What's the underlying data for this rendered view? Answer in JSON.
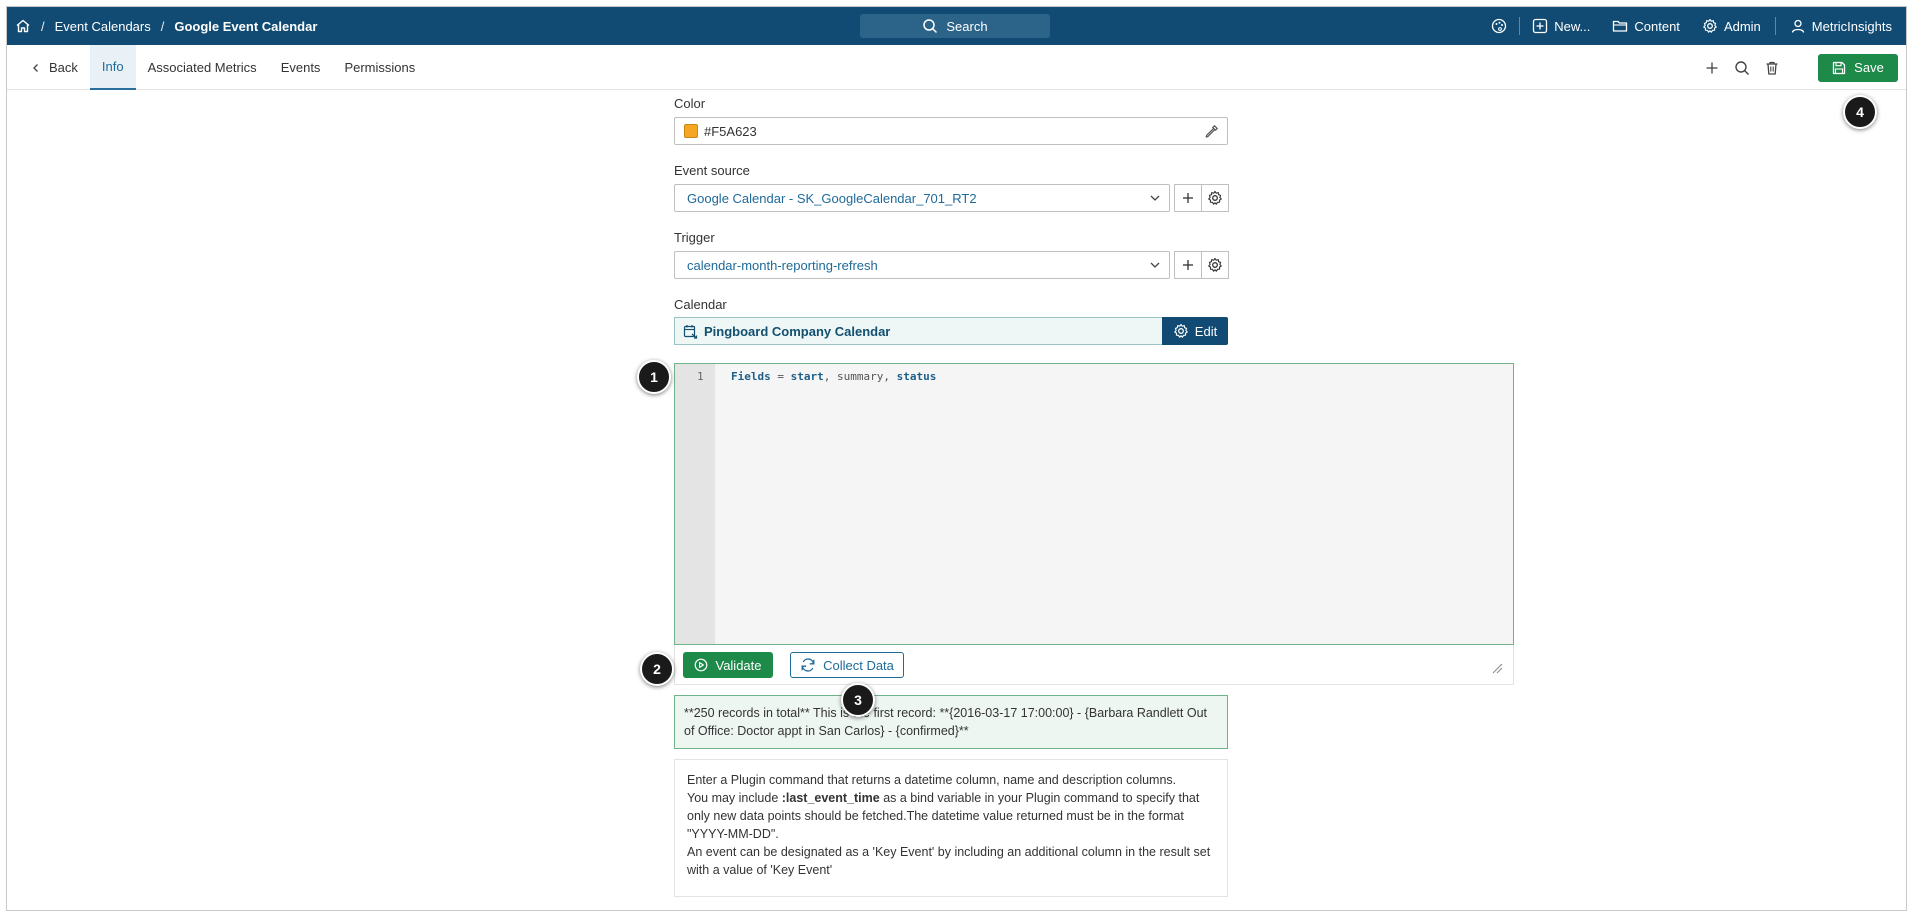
{
  "header": {
    "breadcrumbs": [
      "Event Calendars",
      "Google Event Calendar"
    ],
    "search_label": "Search",
    "new_label": "New...",
    "content_label": "Content",
    "admin_label": "Admin",
    "user_label": "MetricInsights"
  },
  "tabs": {
    "back_label": "Back",
    "items": [
      "Info",
      "Associated Metrics",
      "Events",
      "Permissions"
    ],
    "save_label": "Save"
  },
  "form": {
    "color_label": "Color",
    "color_value": "#F5A623",
    "event_source_label": "Event source",
    "event_source_value": "Google Calendar - SK_GoogleCalendar_701_RT2",
    "trigger_label": "Trigger",
    "trigger_value": "calendar-month-reporting-refresh",
    "calendar_label": "Calendar",
    "calendar_value": "Pingboard Company Calendar",
    "edit_label": "Edit"
  },
  "editor": {
    "line_number": "1",
    "code_tokens": [
      "Fields",
      " = ",
      "start",
      ", ",
      "summary",
      ", ",
      "status"
    ]
  },
  "actions": {
    "validate_label": "Validate",
    "collect_label": "Collect Data"
  },
  "result": {
    "text": "**250 records in total** This is the first record: **{2016-03-17 17:00:00} - {Barbara Randlett Out of Office: Doctor appt in San Carlos} - {confirmed}**"
  },
  "help": {
    "line1": "Enter a Plugin command that returns a datetime column, name and description columns.",
    "line2_pre": "You may include ",
    "line2_bold": ":last_event_time",
    "line2_post": " as a bind variable in your Plugin command to specify that only new data points should be fetched.The datetime value returned must be in the format \"YYYY-MM-DD\".",
    "line3": "An event can be designated as a 'Key Event' by including an additional column in the result set with a value of 'Key Event'"
  },
  "badges": [
    "1",
    "2",
    "3",
    "4"
  ],
  "colors": {
    "header_bg": "#114b73",
    "save_green": "#1d8a49",
    "link_blue": "#1e6a9a",
    "swatch": "#F5A623"
  }
}
